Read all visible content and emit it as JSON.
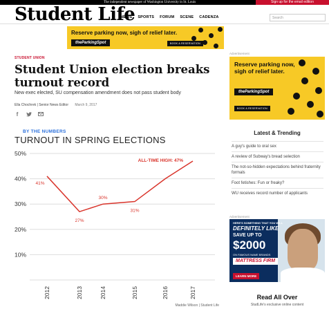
{
  "topbar": {
    "tagline": "The independent newspaper of Washington University in St. Louis",
    "signup": "Sign up for the email edition"
  },
  "header": {
    "masthead": "Student Life",
    "nav": [
      "NEWS",
      "SPORTS",
      "FORUM",
      "SCENE",
      "CADENZA"
    ],
    "search_placeholder": "Search"
  },
  "banner_ad": {
    "headline": "Reserve parking now, sigh of relief later.",
    "logo": "theParkingSpot",
    "cta": "BOOK A RESERVATION"
  },
  "article": {
    "kicker": "STUDENT UNION",
    "title": "Student Union election breaks turnout record",
    "dek": "New exec elected, SU compensation amendment does not pass student body",
    "author": "Ella Chochrek | Senior News Editor",
    "date": "March 9, 2017",
    "share_icons": [
      "facebook-icon",
      "twitter-icon",
      "email-icon"
    ]
  },
  "chart_data": {
    "type": "line",
    "eyebrow": "BY THE NUMBERS",
    "title": "TURNOUT IN SPRING ELECTIONS",
    "x": [
      "2012",
      "2013",
      "2014",
      "2015",
      "2016",
      "2017"
    ],
    "values": [
      41,
      27,
      30,
      31,
      40,
      47
    ],
    "data_labels": [
      "41%",
      "27%",
      "30%",
      "31%",
      "",
      ""
    ],
    "annotation": "ALL-TIME HIGH: 47%",
    "y_ticks": [
      "10%",
      "20%",
      "30%",
      "40%",
      "50%"
    ],
    "ylim": [
      0,
      50
    ],
    "grid": true,
    "line_color": "#d9342b",
    "credit": "Maddie Wilson | Student Life"
  },
  "sidebar": {
    "ad_label": "Advertisement",
    "ad": {
      "headline": "Reserve parking now, sigh of relief later.",
      "logo": "theParkingSpot",
      "cta": "BOOK A RESERVATION"
    },
    "trending_title": "Latest & Trending",
    "trending": [
      "A guy's guide to oral sex",
      "A review of Subway's bread selection",
      "The not-so-hidden expectations behind fraternity formals",
      "Foot fetishes: Fun or freaky?",
      "WU receives record number of applicants"
    ],
    "ad2_label": "Advertisement",
    "mattress_ad": {
      "line1": "HERE'S SOMETHING THAT YOU WILL",
      "line2": "DEFINITELY LIKE",
      "line3": "SAVE UP TO",
      "line4": "$2000",
      "line5": "ON FAMOUS NAME BRANDS",
      "brand": "MATTRESS FIRM",
      "cta": "LEARN MORE"
    },
    "read_all": "Read All Over",
    "read_all_sub": "StudLife's exclusive online content"
  },
  "colors": {
    "accent_red": "#c8102e",
    "ad_yellow": "#f7c926",
    "link_blue": "#2a6fdb"
  }
}
